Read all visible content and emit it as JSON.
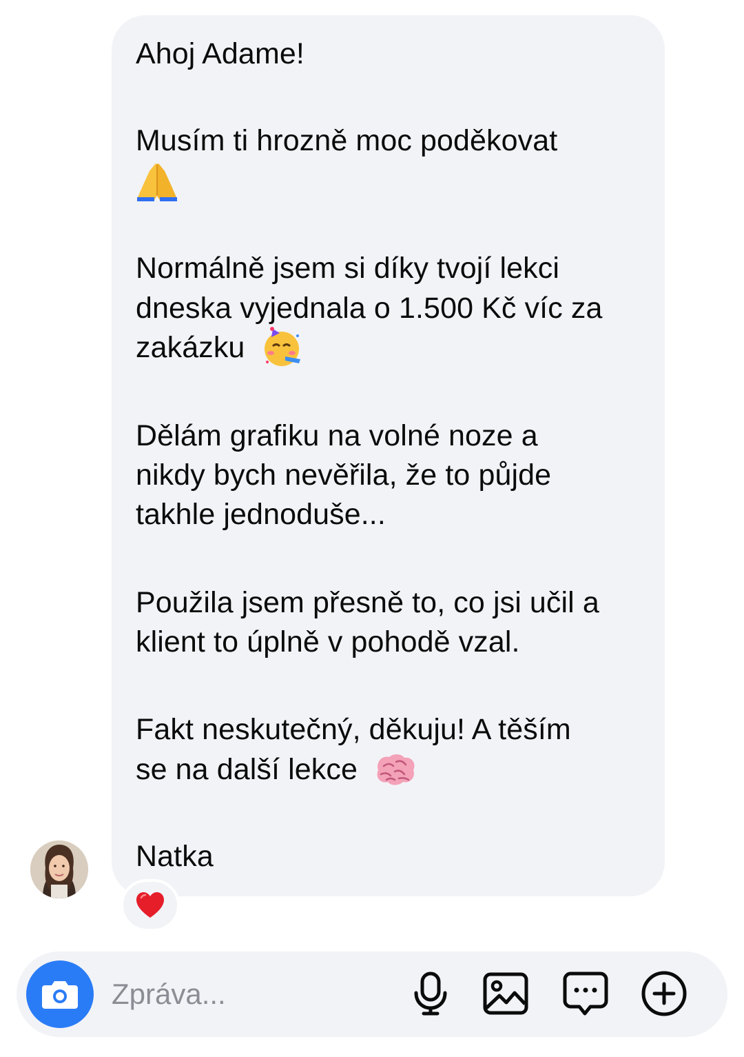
{
  "message": {
    "greeting": "Ahoj Adame!",
    "thanks": "Musím ti hrozně moc poděkovat",
    "paragraph2": [
      "Normálně jsem si díky tvojí lekci",
      "dneska vyjednala o 1.500 Kč víc za",
      "zakázku"
    ],
    "paragraph3": [
      "Dělám grafiku na volné noze a",
      "nikdy bych nevěřila, že to půjde",
      "takhle jednoduše..."
    ],
    "paragraph4": [
      "Použila jsem přesně to, co jsi učil a",
      "klient to úplně v pohodě vzal."
    ],
    "paragraph5": [
      "Fakt neskutečný, děkuju! A těším",
      "se na další lekce"
    ],
    "signature": "Natka",
    "emojis": [
      "folded-hands",
      "partying-face",
      "brain"
    ]
  },
  "reaction": "red-heart",
  "composer": {
    "placeholder": "Zpráva...",
    "icons": [
      "camera-icon",
      "microphone-icon",
      "image-icon",
      "sticker-chat-icon",
      "plus-circle-icon"
    ],
    "accent_color": "#2a7cf6"
  },
  "colors": {
    "bubble": "#f2f3f7",
    "text": "#0b0b0b",
    "placeholder": "#8a8d93"
  }
}
